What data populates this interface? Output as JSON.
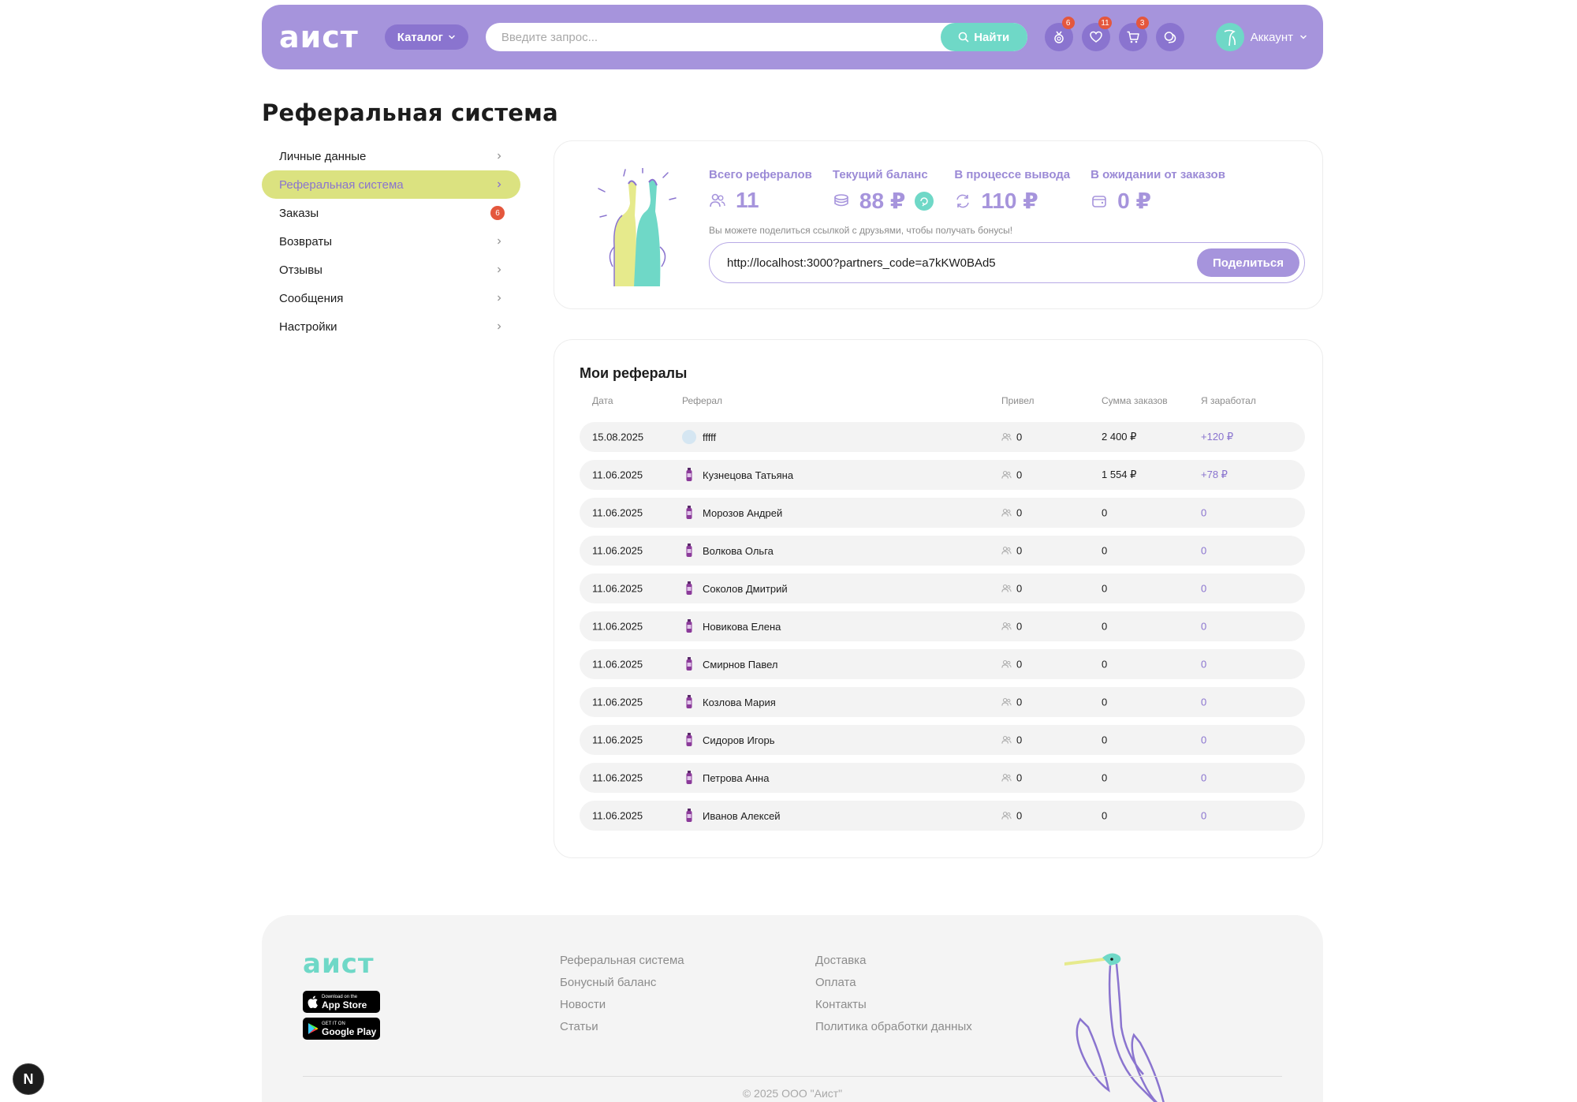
{
  "header": {
    "logo": "аист",
    "catalog_label": "Каталог",
    "search_placeholder": "Введите запрос...",
    "search_button": "Найти",
    "icons": [
      {
        "name": "bonus-icon",
        "badge": "6"
      },
      {
        "name": "heart-icon",
        "badge": "11"
      },
      {
        "name": "cart-icon",
        "badge": "3"
      },
      {
        "name": "chat-icon",
        "badge": ""
      }
    ],
    "account_label": "Аккаунт"
  },
  "page_title": "Реферальная система",
  "sidebar": {
    "items": [
      {
        "label": "Личные данные",
        "badge": ""
      },
      {
        "label": "Реферальная система",
        "badge": "",
        "active": true
      },
      {
        "label": "Заказы",
        "badge": "6"
      },
      {
        "label": "Возвраты",
        "badge": ""
      },
      {
        "label": "Отзывы",
        "badge": ""
      },
      {
        "label": "Сообщения",
        "badge": ""
      },
      {
        "label": "Настройки",
        "badge": ""
      }
    ]
  },
  "referral": {
    "stats": [
      {
        "label": "Всего рефералов",
        "value": "11",
        "icon": "users-icon"
      },
      {
        "label": "Текущий баланс",
        "value": "88 ₽",
        "icon": "coins-icon"
      },
      {
        "label": "В процессе вывода",
        "value": "110 ₽",
        "icon": "refresh-icon"
      },
      {
        "label": "В ожидании от заказов",
        "value": "0 ₽",
        "icon": "wallet-icon"
      }
    ],
    "share_hint": "Вы можете поделиться ссылкой с друзьями, чтобы получать бонусы!",
    "share_link": "http://localhost:3000?partners_code=a7kKW0BAd5",
    "share_button": "Поделиться"
  },
  "referrals_table": {
    "title": "Мои рефералы",
    "columns": [
      "Дата",
      "Реферал",
      "Привел",
      "Сумма заказов",
      "Я заработал"
    ],
    "rows": [
      {
        "date": "15.08.2025",
        "name": "fffff",
        "brought": "0",
        "sum": "2 400 ₽",
        "earned": "+120 ₽",
        "avatar": "photo"
      },
      {
        "date": "11.06.2025",
        "name": "Кузнецова Татьяна",
        "brought": "0",
        "sum": "1 554 ₽",
        "earned": "+78 ₽",
        "avatar": "bottle"
      },
      {
        "date": "11.06.2025",
        "name": "Морозов Андрей",
        "brought": "0",
        "sum": "0",
        "earned": "0",
        "avatar": "bottle"
      },
      {
        "date": "11.06.2025",
        "name": "Волкова Ольга",
        "brought": "0",
        "sum": "0",
        "earned": "0",
        "avatar": "bottle"
      },
      {
        "date": "11.06.2025",
        "name": "Соколов Дмитрий",
        "brought": "0",
        "sum": "0",
        "earned": "0",
        "avatar": "bottle"
      },
      {
        "date": "11.06.2025",
        "name": "Новикова Елена",
        "brought": "0",
        "sum": "0",
        "earned": "0",
        "avatar": "bottle"
      },
      {
        "date": "11.06.2025",
        "name": "Смирнов Павел",
        "brought": "0",
        "sum": "0",
        "earned": "0",
        "avatar": "bottle"
      },
      {
        "date": "11.06.2025",
        "name": "Козлова Мария",
        "brought": "0",
        "sum": "0",
        "earned": "0",
        "avatar": "bottle"
      },
      {
        "date": "11.06.2025",
        "name": "Сидоров Игорь",
        "brought": "0",
        "sum": "0",
        "earned": "0",
        "avatar": "bottle"
      },
      {
        "date": "11.06.2025",
        "name": "Петрова Анна",
        "brought": "0",
        "sum": "0",
        "earned": "0",
        "avatar": "bottle"
      },
      {
        "date": "11.06.2025",
        "name": "Иванов Алексей",
        "brought": "0",
        "sum": "0",
        "earned": "0",
        "avatar": "bottle"
      }
    ]
  },
  "footer": {
    "logo": "аист",
    "app_store": {
      "small": "Download on the",
      "big": "App Store"
    },
    "google_play": {
      "small": "GET IT ON",
      "big": "Google Play"
    },
    "col1": [
      "Реферальная система",
      "Бонусный баланс",
      "Новости",
      "Статьи"
    ],
    "col2": [
      "Доставка",
      "Оплата",
      "Контакты",
      "Политика обработки данных"
    ],
    "copyright": "© 2025 ООО \"Аист\""
  },
  "dev_badge": "N",
  "colors": {
    "accent": "#a694dc",
    "accent_dark": "#8a74cf",
    "mint": "#6fd8c7",
    "lime": "#dbe280",
    "badge": "#e4573d"
  }
}
